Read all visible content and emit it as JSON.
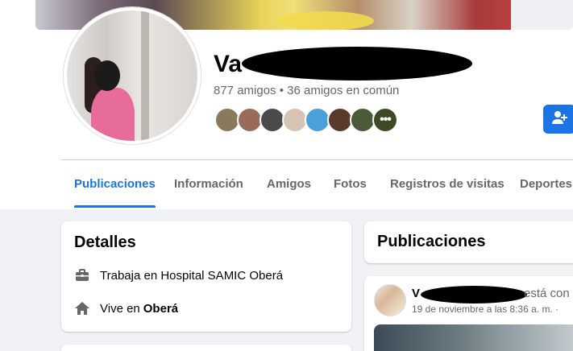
{
  "profile": {
    "name_visible": "Va",
    "friends_summary": "877 amigos • 36 amigos en común",
    "friend_faces": [
      {
        "color": "#8a7a5c"
      },
      {
        "color": "#9a6a5a"
      },
      {
        "color": "#4a4a4a"
      },
      {
        "color": "#d6c4b4"
      },
      {
        "color": "#4aa0d8"
      },
      {
        "color": "#5a3a2a"
      },
      {
        "color": "#4c5a3a"
      },
      {
        "color": "#3d4a23"
      }
    ],
    "more_faces_label": "•••"
  },
  "tabs": [
    {
      "label": "Publicaciones",
      "active": true
    },
    {
      "label": "Información",
      "active": false
    },
    {
      "label": "Amigos",
      "active": false
    },
    {
      "label": "Fotos",
      "active": false
    },
    {
      "label": "Registros de visitas",
      "active": false
    },
    {
      "label": "Deportes",
      "active": false
    }
  ],
  "details": {
    "title": "Detalles",
    "work": "Trabaja en Hospital SAMIC Oberá",
    "lives_prefix": "Vive en",
    "lives_city": "Oberá"
  },
  "posts": {
    "title": "Publicaciones",
    "post": {
      "author_visible": "V",
      "action": "está con",
      "time": "19 de noviembre a las 8:36 a. m. ·"
    }
  },
  "colors": {
    "accent": "#1b74e4",
    "secondary_text": "#65676b",
    "background": "#f0f2f5"
  },
  "icons": {
    "add_friend": "add-friend-icon",
    "work": "briefcase-icon",
    "home": "home-icon"
  }
}
